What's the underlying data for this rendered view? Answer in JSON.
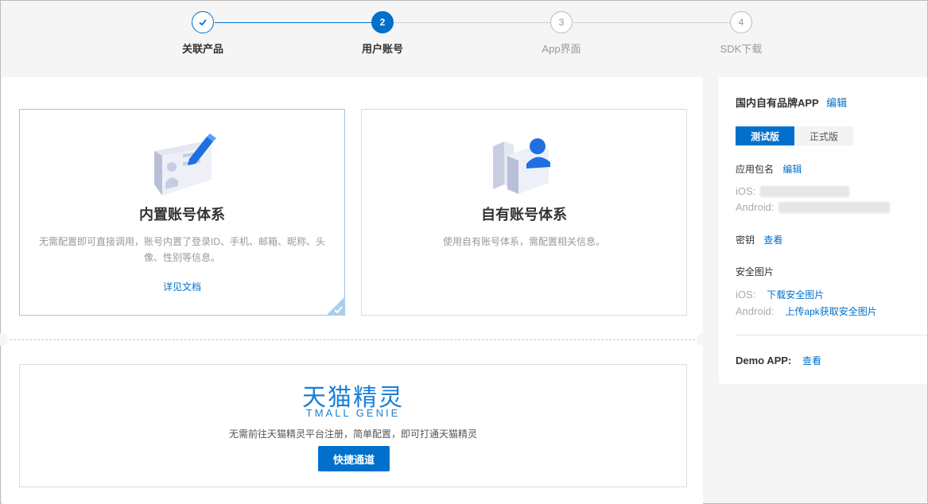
{
  "stepper": {
    "steps": [
      {
        "number": "",
        "label": "关联产品",
        "state": "done"
      },
      {
        "number": "2",
        "label": "用户账号",
        "state": "active"
      },
      {
        "number": "3",
        "label": "App界面",
        "state": "todo"
      },
      {
        "number": "4",
        "label": "SDK下载",
        "state": "todo"
      }
    ]
  },
  "cards": {
    "builtin": {
      "title": "内置账号体系",
      "desc": "无需配置即可直接调用，账号内置了登录ID、手机、邮箱、昵称、头像、性别等信息。",
      "link": "详见文档",
      "selected": true
    },
    "own": {
      "title": "自有账号体系",
      "desc": "使用自有账号体系，需配置相关信息。"
    }
  },
  "genie": {
    "logo_cn": "天猫精灵",
    "logo_en": "TMALL GENIE",
    "desc": "无需前往天猫精灵平台注册，简单配置，即可打通天猫精灵",
    "button": "快捷通道"
  },
  "sidebar": {
    "title": "国内自有品牌APP",
    "title_edit": "编辑",
    "tabs": [
      "测试版",
      "正式版"
    ],
    "package_label": "应用包名",
    "package_edit": "编辑",
    "ios_label": "iOS:",
    "android_label": "Android:",
    "key_label": "密钥",
    "key_view": "查看",
    "secure_image_label": "安全图片",
    "secure_ios_label": "iOS:",
    "secure_ios_link": "下载安全图片",
    "secure_android_label": "Android:",
    "secure_android_link": "上传apk获取安全图片",
    "demo_label": "Demo APP:",
    "demo_view": "查看"
  },
  "colors": {
    "accent": "#0070cc",
    "genie": "#1a7fd6"
  }
}
